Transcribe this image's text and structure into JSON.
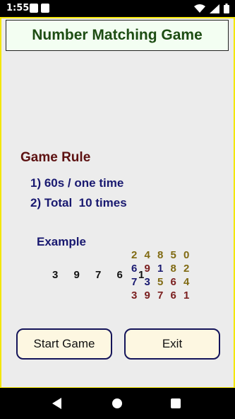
{
  "status_bar": {
    "time": "1:55"
  },
  "app": {
    "title": "Number Matching Game",
    "rule_title": "Game Rule",
    "rules": [
      "1) 60s / one time",
      "2) Total  10 times"
    ],
    "example_label": "Example",
    "example_sequence": "3 9 7 6 1",
    "example_grid": [
      [
        {
          "value": "2",
          "color": "#806a12"
        },
        {
          "value": "4",
          "color": "#806a12"
        },
        {
          "value": "8",
          "color": "#806a12"
        },
        {
          "value": "5",
          "color": "#806a12"
        },
        {
          "value": "0",
          "color": "#806a12"
        }
      ],
      [
        {
          "value": "6",
          "color": "#191970"
        },
        {
          "value": "9",
          "color": "#7a1e1e"
        },
        {
          "value": "1",
          "color": "#191970"
        },
        {
          "value": "8",
          "color": "#806a12"
        },
        {
          "value": "2",
          "color": "#806a12"
        }
      ],
      [
        {
          "value": "7",
          "color": "#191970"
        },
        {
          "value": "3",
          "color": "#191970"
        },
        {
          "value": "5",
          "color": "#806a12"
        },
        {
          "value": "6",
          "color": "#7a1e1e"
        },
        {
          "value": "4",
          "color": "#806a12"
        }
      ],
      [
        {
          "value": "3",
          "color": "#7a1e1e"
        },
        {
          "value": "9",
          "color": "#7a1e1e"
        },
        {
          "value": "7",
          "color": "#7a1e1e"
        },
        {
          "value": "6",
          "color": "#7a1e1e"
        },
        {
          "value": "1",
          "color": "#7a1e1e"
        }
      ]
    ],
    "buttons": {
      "start": "Start Game",
      "exit": "Exit"
    }
  },
  "colors": {
    "frame_border": "#f4e600",
    "title_text": "#1d4c13",
    "rule_title": "#5d1212",
    "rule_text": "#191970",
    "button_bg": "#fdf7e1",
    "button_border": "#14145a"
  },
  "icons": [
    "notification-icon",
    "photo-icon",
    "wifi-icon",
    "signal-icon",
    "battery-icon",
    "back-icon",
    "home-icon",
    "recents-icon"
  ]
}
